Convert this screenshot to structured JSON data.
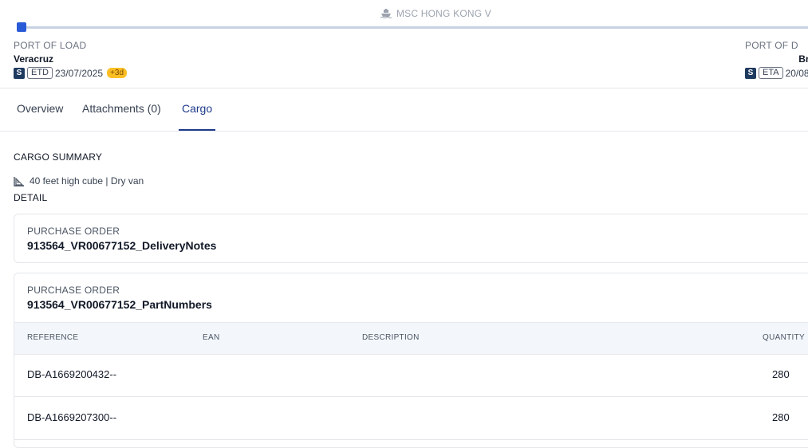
{
  "route": {
    "vessel_name": "MSC HONG KONG V",
    "vessel_icon": "ship-icon",
    "load": {
      "caption": "PORT OF LOAD",
      "name": "Veracruz",
      "badge": "S",
      "date_kind": "ETD",
      "date": "23/07/2025",
      "delay": "+3d"
    },
    "discharge": {
      "caption": "PORT OF D",
      "name": "Br",
      "badge": "S",
      "date_kind": "ETA",
      "date": "20/08"
    }
  },
  "tabs": [
    {
      "label": "Overview"
    },
    {
      "label": "Attachments (0)"
    },
    {
      "label": "Cargo",
      "active": true
    }
  ],
  "cargo": {
    "summary_title": "CARGO SUMMARY",
    "container_icon": "container-icon",
    "container_desc": "40 feet high cube | Dry van",
    "detail_title": "DETAIL",
    "orders": [
      {
        "caption": "PURCHASE ORDER",
        "value": "913564_VR00677152_DeliveryNotes"
      },
      {
        "caption": "PURCHASE ORDER",
        "value": "913564_VR00677152_PartNumbers",
        "columns": [
          "REFERENCE",
          "EAN",
          "DESCRIPTION",
          "QUANTITY"
        ],
        "rows": [
          {
            "reference": "DB-A1669200432--",
            "ean": "",
            "description": "",
            "quantity": "280"
          },
          {
            "reference": "DB-A1669207300--",
            "ean": "",
            "description": "",
            "quantity": "280"
          }
        ]
      }
    ]
  },
  "colors": {
    "accent": "#1e3a8a",
    "progress_marker": "#2a5bd7",
    "delay_badge": "#fbbf24"
  }
}
